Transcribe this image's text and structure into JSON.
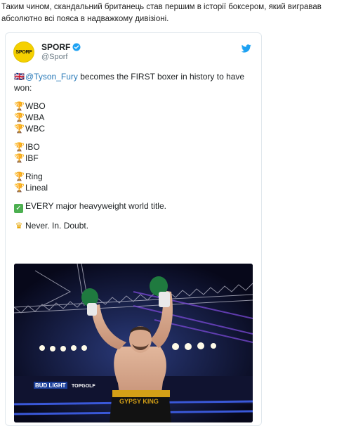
{
  "article": {
    "intro_text": "Таким чином, скандальний британець став першим в історії боксером, який вигравав абсолютно всі пояса в надважкому дивізіоні."
  },
  "tweet": {
    "author": {
      "avatar_text": "SPORF",
      "display_name": "SPORF",
      "handle": "@Sporf",
      "verified": true
    },
    "text_prefix_flag": "🇬🇧",
    "mention": "@Tyson_Fury",
    "text_main": " becomes the FIRST boxer in history to have won:",
    "title_groups": [
      [
        "WBO",
        "WBA",
        "WBC"
      ],
      [
        "IBO",
        "IBF"
      ],
      [
        "Ring",
        "Lineal"
      ]
    ],
    "every_title_line": "EVERY major heavyweight world title.",
    "closing_line": "Never. In. Doubt.",
    "photo": {
      "banner_text_1": "BUD LIGHT",
      "banner_text_2": "TOPGOLF",
      "shorts_text": "GYPSY KING"
    }
  },
  "colors": {
    "link": "#2b7bb9",
    "twitter_blue": "#1da1f2",
    "avatar_yellow": "#f5d000",
    "check_green": "#4caf50"
  },
  "icons": [
    "twitter-bird-icon",
    "verified-badge-icon",
    "trophy-icon",
    "check-mark-icon",
    "crown-icon",
    "uk-flag-icon"
  ]
}
